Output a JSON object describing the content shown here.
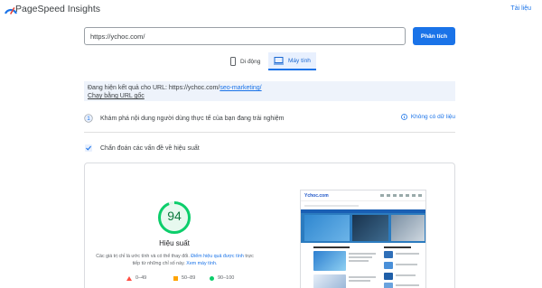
{
  "header": {
    "brand": "PageSpeed Insights",
    "docs_link": "Tài liệu",
    "logo_icon": "pagespeed-gauge-icon"
  },
  "search": {
    "url_value": "https://ychoc.com/",
    "analyze_label": "Phân tích"
  },
  "tabs": [
    {
      "label": "Di động",
      "icon": "phone-icon",
      "active": false
    },
    {
      "label": "Máy tính",
      "icon": "desktop-icon",
      "active": true
    }
  ],
  "notice": {
    "prefix": "Đang hiện kết quả cho URL: https://ychoc.com/",
    "link": "seo-marketing/",
    "original_link": "Chạy bằng URL gốc"
  },
  "core_web_vitals": {
    "title": "Khám phá nội dung người dùng thực tế của bạn đang trải nghiệm",
    "no_data": "Không có dữ liệu"
  },
  "diagnostics": {
    "title": "Chẩn đoán các vấn đề về hiệu suất"
  },
  "performance": {
    "score": "94",
    "score_fraction": 0.94,
    "label": "Hiệu suất",
    "note_prefix": "Các giá trị chỉ là ước tính và có thể thay đổi.",
    "note_link1": "Điểm hiệu quả được tính",
    "note_middle": "trực tiếp từ những chỉ số này.",
    "note_link2": "Xem máy tính."
  },
  "legend": {
    "fail": "0–49",
    "average": "50–89",
    "pass": "90–100"
  },
  "screenshot": {
    "site_logo": "Ychoc.com"
  },
  "colors": {
    "accent": "#1a73e8",
    "pass": "#0cce6b",
    "pass_text": "#0c7a3e",
    "average": "#ffa400",
    "fail": "#ff4e42"
  }
}
